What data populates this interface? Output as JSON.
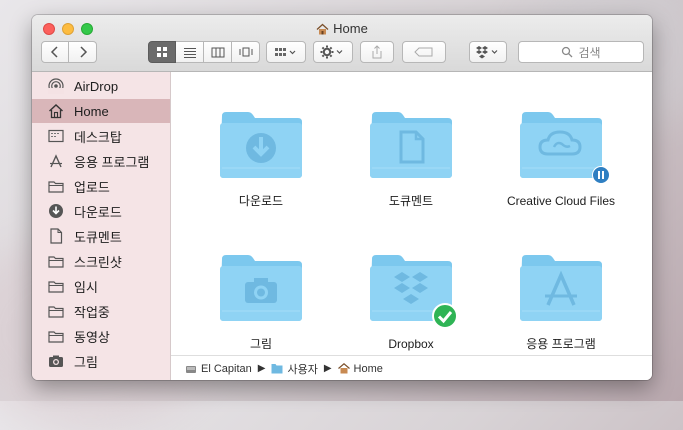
{
  "window": {
    "title": "Home"
  },
  "toolbar": {
    "search_placeholder": "검색"
  },
  "sidebar": {
    "items": [
      {
        "label": "AirDrop",
        "icon": "airdrop-icon"
      },
      {
        "label": "Home",
        "icon": "home-icon",
        "selected": true
      },
      {
        "label": "데스크탑",
        "icon": "desktop-icon"
      },
      {
        "label": "응용 프로그램",
        "icon": "applications-icon"
      },
      {
        "label": "업로드",
        "icon": "folder-icon"
      },
      {
        "label": "다운로드",
        "icon": "download-icon"
      },
      {
        "label": "도큐멘트",
        "icon": "document-icon"
      },
      {
        "label": "스크린샷",
        "icon": "folder-icon"
      },
      {
        "label": "임시",
        "icon": "folder-icon"
      },
      {
        "label": "작업중",
        "icon": "folder-icon"
      },
      {
        "label": "동영상",
        "icon": "folder-icon"
      },
      {
        "label": "그림",
        "icon": "camera-icon"
      }
    ]
  },
  "files": [
    {
      "name": "다운로드",
      "icon": "download-folder-icon"
    },
    {
      "name": "도큐멘트",
      "icon": "documents-folder-icon"
    },
    {
      "name": "Creative Cloud Files",
      "icon": "creative-cloud-folder-icon",
      "badge": "pause"
    },
    {
      "name": "그림",
      "icon": "pictures-folder-icon"
    },
    {
      "name": "Dropbox",
      "icon": "dropbox-folder-icon",
      "badge": "synced"
    },
    {
      "name": "응용 프로그램",
      "icon": "applications-folder-icon"
    }
  ],
  "pathbar": {
    "items": [
      {
        "label": "El Capitan",
        "icon": "disk-icon"
      },
      {
        "label": "사용자",
        "icon": "folder-icon"
      },
      {
        "label": "Home",
        "icon": "home-icon"
      }
    ]
  },
  "colors": {
    "folder": "#8fd3f4",
    "selected_sidebar": "#d9b6b9",
    "badge_green": "#2fb455",
    "badge_blue": "#2f7fc2"
  }
}
